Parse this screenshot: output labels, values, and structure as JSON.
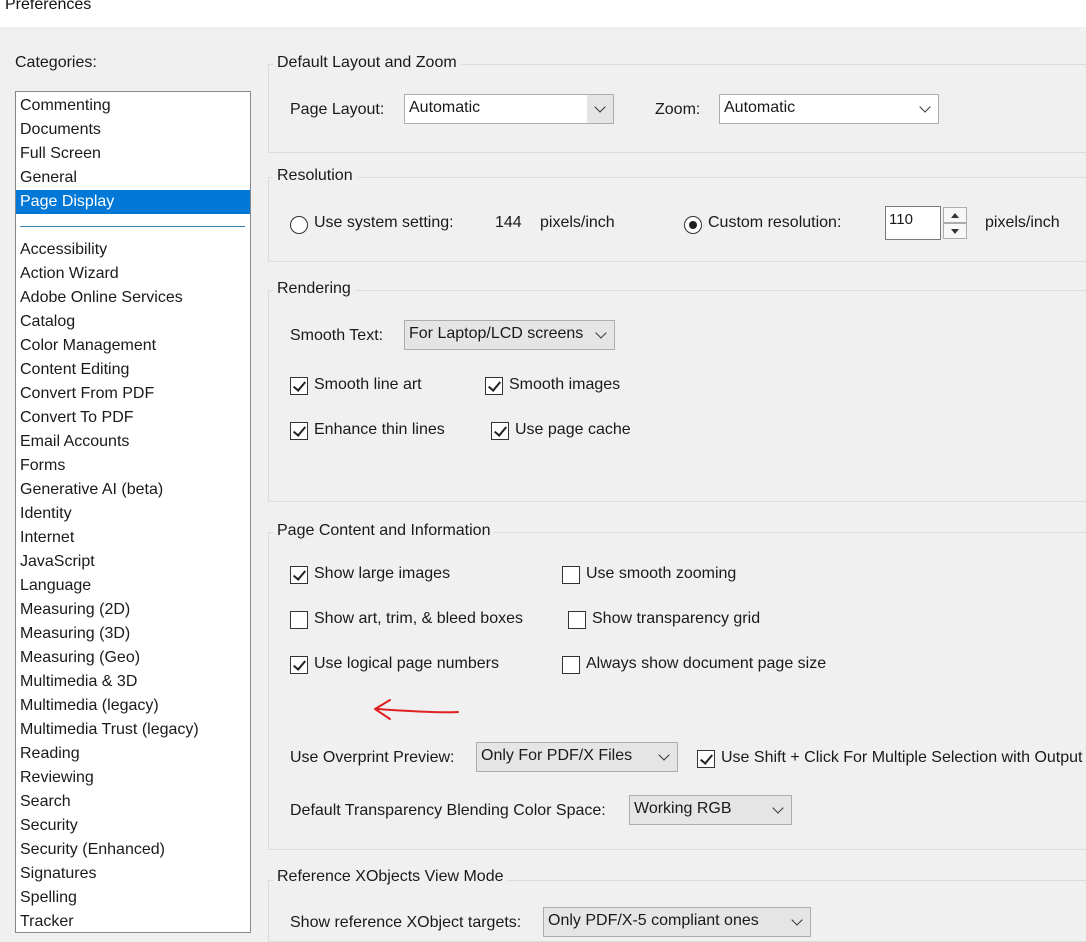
{
  "window": {
    "title": "Preferences"
  },
  "categories": {
    "label": "Categories:",
    "top_items": [
      "Commenting",
      "Documents",
      "Full Screen",
      "General",
      "Page Display"
    ],
    "selected": "Page Display",
    "items": [
      "Accessibility",
      "Action Wizard",
      "Adobe Online Services",
      "Catalog",
      "Color Management",
      "Content Editing",
      "Convert From PDF",
      "Convert To PDF",
      "Email Accounts",
      "Forms",
      "Generative AI (beta)",
      "Identity",
      "Internet",
      "JavaScript",
      "Language",
      "Measuring (2D)",
      "Measuring (3D)",
      "Measuring (Geo)",
      "Multimedia & 3D",
      "Multimedia (legacy)",
      "Multimedia Trust (legacy)",
      "Reading",
      "Reviewing",
      "Search",
      "Security",
      "Security (Enhanced)",
      "Signatures",
      "Spelling",
      "Tracker"
    ]
  },
  "layout_zoom": {
    "title": "Default Layout and Zoom",
    "page_layout_label": "Page Layout:",
    "page_layout_value": "Automatic",
    "zoom_label": "Zoom:",
    "zoom_value": "Automatic"
  },
  "resolution": {
    "title": "Resolution",
    "system_label": "Use system setting:",
    "system_value": "144",
    "system_unit": "pixels/inch",
    "custom_label": "Custom resolution:",
    "custom_value": "110",
    "custom_unit": "pixels/inch",
    "selected": "custom"
  },
  "rendering": {
    "title": "Rendering",
    "smooth_text_label": "Smooth Text:",
    "smooth_text_value": "For Laptop/LCD screens",
    "smooth_line_art": "Smooth line art",
    "smooth_images": "Smooth images",
    "enhance_thin_lines": "Enhance thin lines",
    "use_page_cache": "Use page cache"
  },
  "page_content": {
    "title": "Page Content and Information",
    "show_large_images": "Show large images",
    "use_smooth_zooming": "Use smooth zooming",
    "show_boxes": "Show art, trim, & bleed boxes",
    "show_transparency_grid": "Show transparency grid",
    "use_logical_page_numbers": "Use logical page numbers",
    "always_show_page_size": "Always show document page size",
    "overprint_label": "Use Overprint Preview:",
    "overprint_value": "Only For PDF/X Files",
    "shift_click_label": "Use Shift + Click For Multiple Selection with Output",
    "blending_label": "Default Transparency Blending Color Space:",
    "blending_value": "Working RGB"
  },
  "xobjects": {
    "title": "Reference XObjects View Mode",
    "show_label": "Show reference XObject targets:",
    "show_value": "Only PDF/X-5 compliant ones"
  },
  "colors": {
    "selection": "#0078d7",
    "annotation_arrow": "#e02020"
  }
}
